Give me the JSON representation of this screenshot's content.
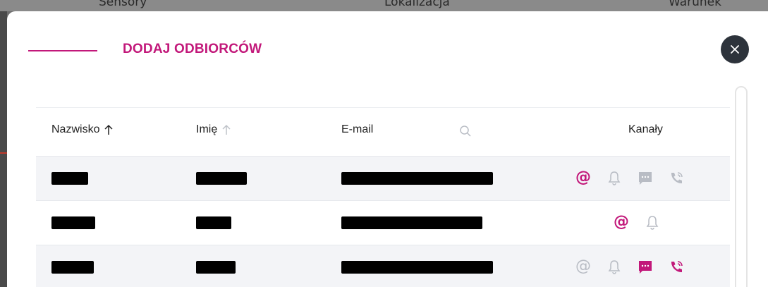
{
  "backdrop": {
    "col1": "Sensory",
    "col2": "Lokalizacja",
    "col3": "Warunek"
  },
  "modal": {
    "title": "DODAJ ODBIORCÓW",
    "close_icon": "close-icon"
  },
  "table": {
    "columns": [
      {
        "label": "Nazwisko",
        "sort": "ascending-active"
      },
      {
        "label": "Imię",
        "sort": "ascending-inactive"
      },
      {
        "label": "E-mail",
        "search": "search-icon"
      },
      {
        "label": "Kanały"
      }
    ],
    "rows": [
      {
        "last_name": "[redacted]",
        "first_name": "[redacted]",
        "email": "[redacted]",
        "channels": [
          {
            "name": "email",
            "icon": "at-icon",
            "active": true
          },
          {
            "name": "push",
            "icon": "bell-icon",
            "active": false
          },
          {
            "name": "sms",
            "icon": "message-icon",
            "active": false
          },
          {
            "name": "phone",
            "icon": "phone-icon",
            "active": false
          }
        ]
      },
      {
        "last_name": "[redacted]",
        "first_name": "[redacted]",
        "email": "[redacted]",
        "channels": [
          {
            "name": "email",
            "icon": "at-icon",
            "active": true
          },
          {
            "name": "push",
            "icon": "bell-icon",
            "active": false
          }
        ]
      },
      {
        "last_name": "[redacted]",
        "first_name": "[redacted]",
        "email": "[redacted]",
        "channels": [
          {
            "name": "email",
            "icon": "at-icon",
            "active": false
          },
          {
            "name": "push",
            "icon": "bell-icon",
            "active": false
          },
          {
            "name": "sms",
            "icon": "message-icon",
            "active": true
          },
          {
            "name": "phone",
            "icon": "phone-icon",
            "active": true
          }
        ]
      }
    ]
  },
  "colors": {
    "accent": "#c2187a",
    "inactive_icon": "#b8bcc4",
    "close_bg": "#2d333b",
    "row_alt": "#f3f4f7"
  }
}
